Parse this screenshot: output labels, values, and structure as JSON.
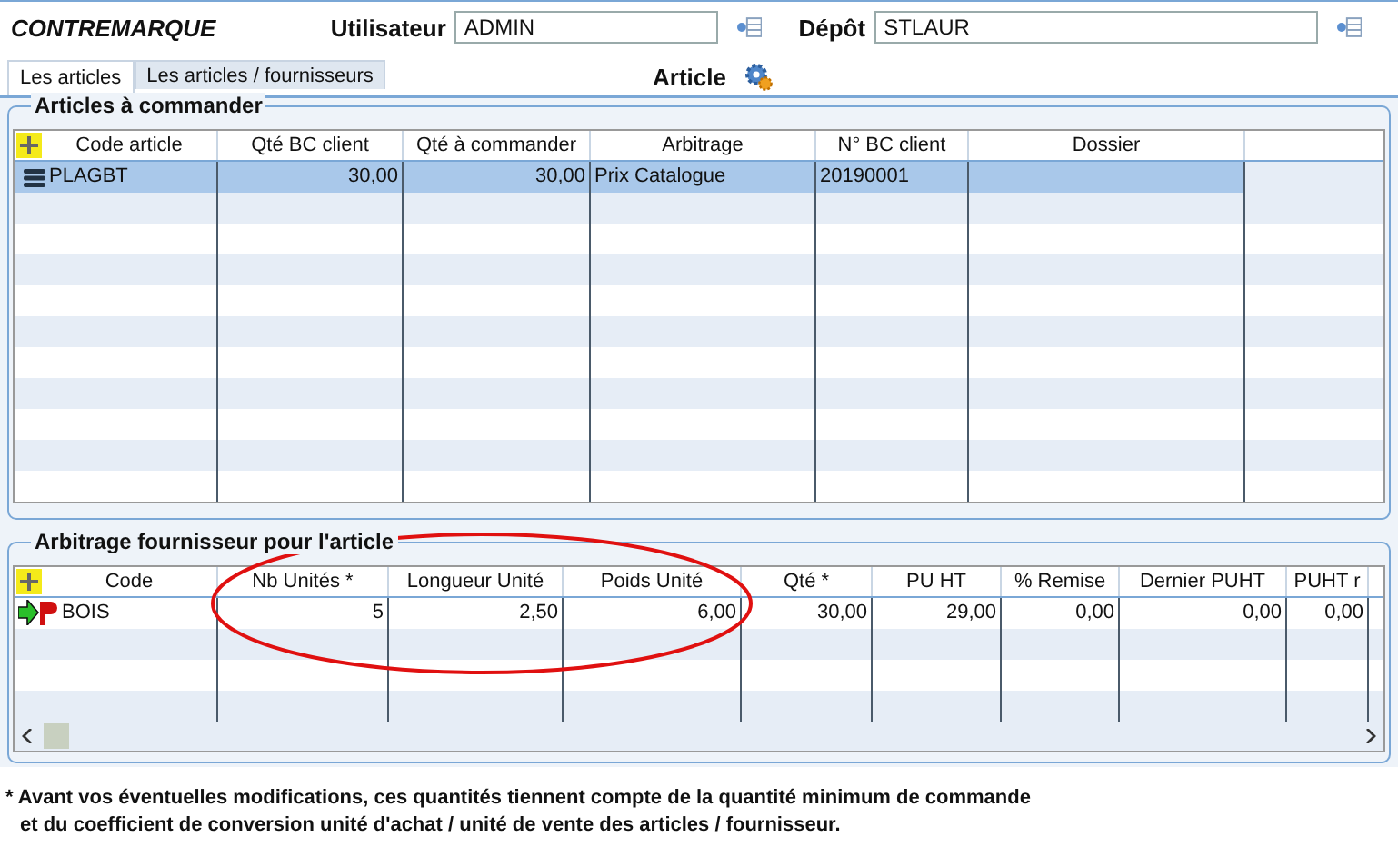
{
  "header": {
    "title": "CONTREMARQUE",
    "user_label": "Utilisateur",
    "user_value": "ADMIN",
    "depot_label": "Dépôt",
    "depot_value": "STLAUR"
  },
  "tabs": [
    {
      "label": "Les articles",
      "selected": true
    },
    {
      "label": "Les articles / fournisseurs",
      "selected": false
    }
  ],
  "article_label": "Article",
  "articles_panel": {
    "title": "Articles à commander",
    "columns": [
      "Code article",
      "Qté BC client",
      "Qté à commander",
      "Arbitrage",
      "N° BC client",
      "Dossier"
    ],
    "rows": [
      {
        "selected": true,
        "cells": [
          "PLAGBT",
          "30,00",
          "30,00",
          "Prix Catalogue",
          "20190001",
          ""
        ]
      }
    ]
  },
  "supplier_panel": {
    "title": "Arbitrage fournisseur pour l'article",
    "columns": [
      "Code",
      "Nb Unités *",
      "Longueur Unité",
      "Poids Unité",
      "Qté *",
      "PU HT",
      "% Remise",
      "Dernier PUHT",
      "PUHT r"
    ],
    "rows": [
      {
        "selected": false,
        "cells": [
          "BOIS",
          "5",
          "2,50",
          "6,00",
          "30,00",
          "29,00",
          "0,00",
          "0,00",
          "0,00"
        ]
      }
    ]
  },
  "footnote": [
    "* Avant vos éventuelles modifications, ces quantités tiennent compte de la quantité minimum de commande",
    "et du coefficient de conversion unité d'achat / unité de vente des articles / fournisseur."
  ]
}
